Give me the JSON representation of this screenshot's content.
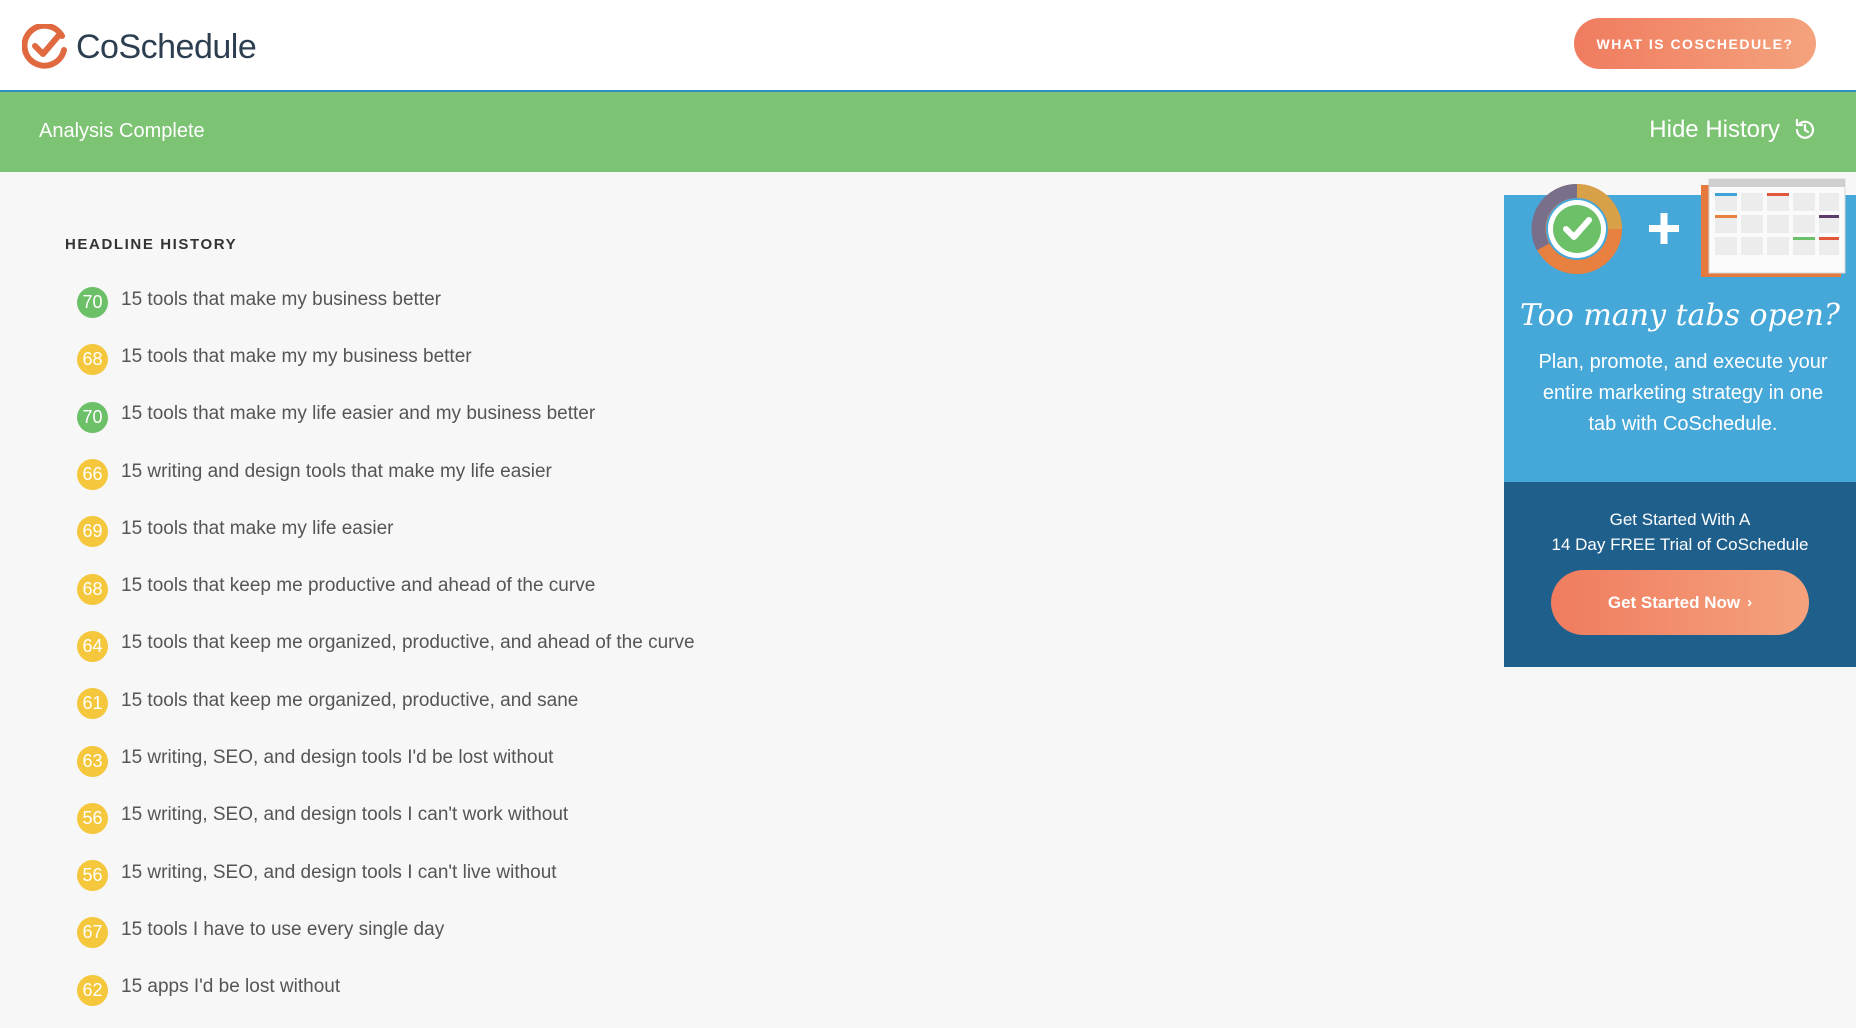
{
  "header": {
    "brand": "CoSchedule",
    "what_button": "WHAT IS COSCHEDULE?"
  },
  "status": {
    "message": "Analysis Complete",
    "hide_history": "Hide History"
  },
  "history": {
    "title": "HEADLINE HISTORY",
    "items": [
      {
        "score": "70",
        "tone": "green",
        "headline": "15 tools that make my business better"
      },
      {
        "score": "68",
        "tone": "yellow",
        "headline": "15 tools that make my my business better"
      },
      {
        "score": "70",
        "tone": "green",
        "headline": "15 tools that make my life easier and my business better"
      },
      {
        "score": "66",
        "tone": "yellow",
        "headline": "15 writing and design tools that make my life easier"
      },
      {
        "score": "69",
        "tone": "yellow",
        "headline": "15 tools that make my life easier"
      },
      {
        "score": "68",
        "tone": "yellow",
        "headline": "15 tools that keep me productive and ahead of the curve"
      },
      {
        "score": "64",
        "tone": "yellow",
        "headline": "15 tools that keep me organized, productive, and ahead of the curve"
      },
      {
        "score": "61",
        "tone": "yellow",
        "headline": "15 tools that keep me organized, productive, and sane"
      },
      {
        "score": "63",
        "tone": "yellow",
        "headline": "15 writing, SEO, and design tools I'd be lost without"
      },
      {
        "score": "56",
        "tone": "yellow",
        "headline": "15 writing, SEO, and design tools I can't work without"
      },
      {
        "score": "56",
        "tone": "yellow",
        "headline": "15 writing, SEO, and design tools I can't live without"
      },
      {
        "score": "67",
        "tone": "yellow",
        "headline": "15 tools I have to use every single day"
      },
      {
        "score": "62",
        "tone": "yellow",
        "headline": "15 apps I'd be lost without"
      }
    ]
  },
  "promo": {
    "heading": "Too many tabs open?",
    "body": "Plan, promote, and execute your entire marketing strategy in one tab with CoSchedule.",
    "cta_line1": "Get Started With A",
    "cta_line2": "14 Day FREE Trial of CoSchedule",
    "cta_button": "Get Started Now"
  },
  "colors": {
    "green_bar": "#7dc374",
    "score_green": "#6cc068",
    "score_yellow": "#f4c73d",
    "promo_blue": "#46a7d9",
    "promo_dark": "#1f5f8c",
    "cta_orange": "#f07c5f"
  }
}
